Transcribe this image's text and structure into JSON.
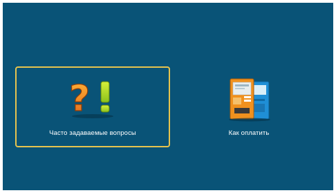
{
  "menu": {
    "items": [
      {
        "label": "Часто задаваемые вопросы",
        "icon": "question-exclamation-icon",
        "selected": true
      },
      {
        "label": "Как оплатить",
        "icon": "payment-terminal-icon",
        "selected": false
      }
    ]
  },
  "colors": {
    "background": "#095377",
    "selection_border": "#e7c44e",
    "question_mark": "#f08a1c",
    "exclamation_mark": "#b4dd24",
    "terminal_orange": "#f0911e",
    "terminal_blue": "#1f8fd6"
  }
}
